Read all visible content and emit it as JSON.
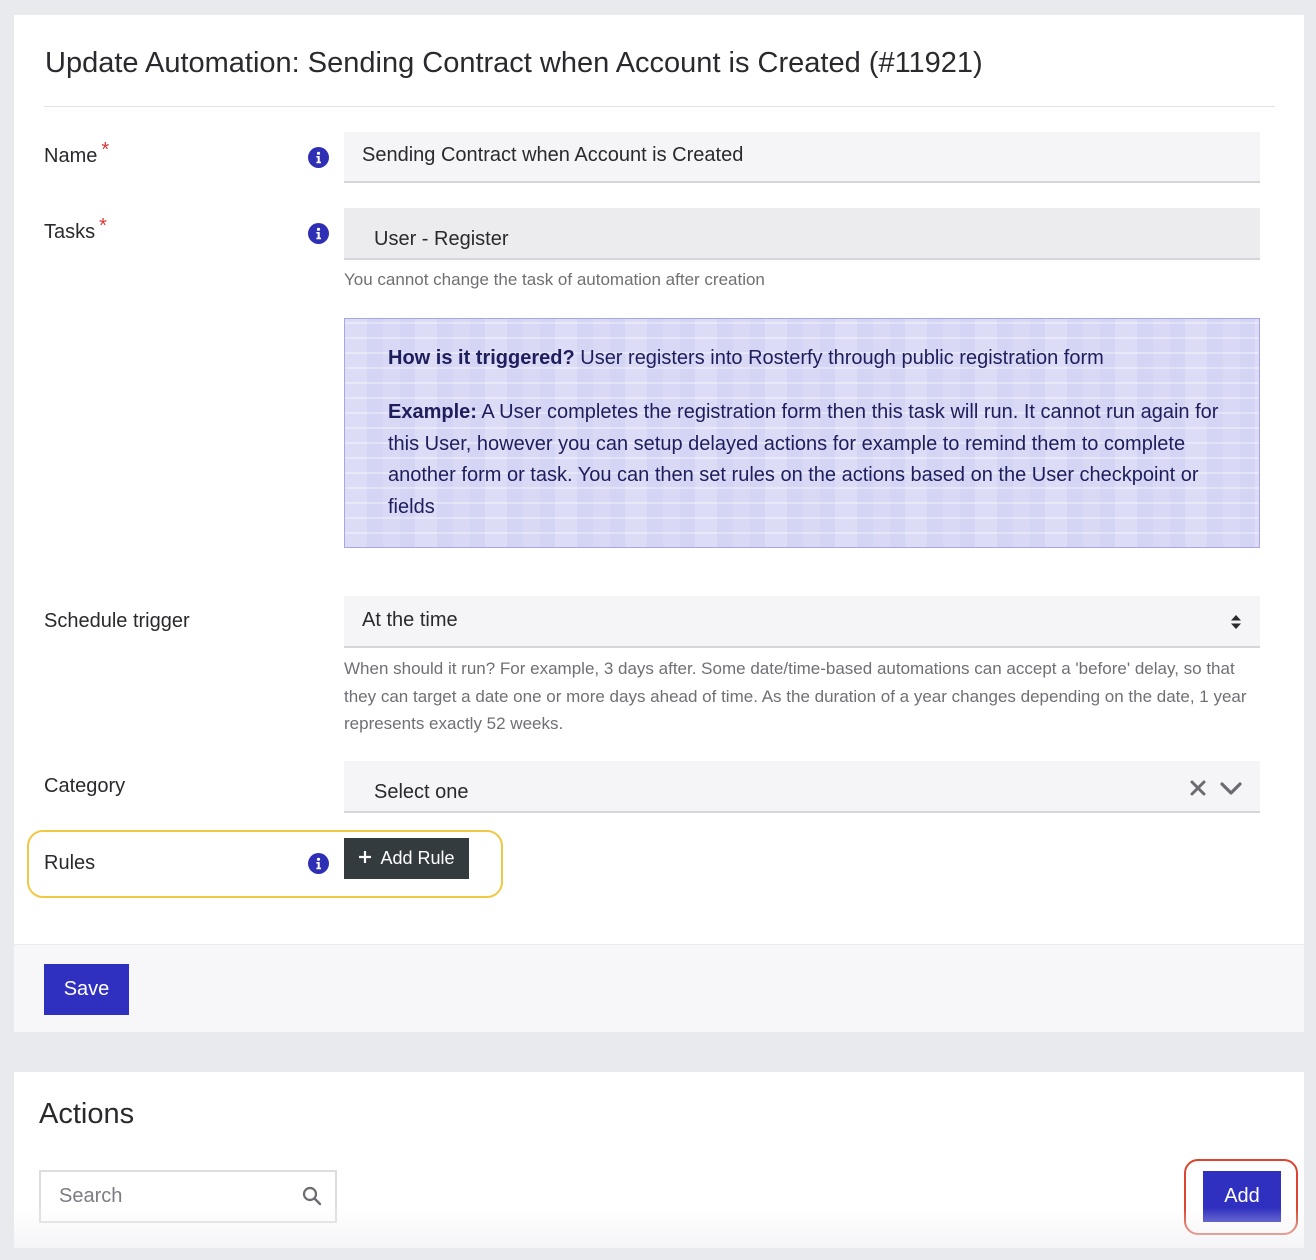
{
  "header": {
    "title": "Update Automation: Sending Contract when Account is Created (#11921)"
  },
  "form": {
    "name": {
      "label": "Name",
      "required_mark": "*",
      "value": "Sending Contract when Account is Created"
    },
    "tasks": {
      "label": "Tasks",
      "required_mark": "*",
      "value": "User - Register",
      "help": "You cannot change the task of automation after creation"
    },
    "callout": {
      "trigger_heading": "How is it triggered?",
      "trigger_text": " User registers into Rosterfy through public registration form",
      "example_heading": "Example:",
      "example_text": " A User completes the registration form then this task will run. It cannot run again for this User, however you can setup delayed actions for example to remind them to complete another form or task. You can then set rules on the actions based on the User checkpoint or fields"
    },
    "schedule_trigger": {
      "label": "Schedule trigger",
      "value": "At the time",
      "help": "When should it run? For example, 3 days after. Some date/time-based automations can accept a 'before' delay, so that they can target a date one or more days ahead of time. As the duration of a year changes depending on the date, 1 year represents exactly 52 weeks."
    },
    "category": {
      "label": "Category",
      "value": "Select one"
    },
    "rules": {
      "label": "Rules",
      "button_label": "Add Rule"
    },
    "save_label": "Save"
  },
  "actions": {
    "title": "Actions",
    "search_placeholder": "Search",
    "add_label": "Add"
  },
  "icons": {
    "info": "info-icon",
    "plus": "plus-icon",
    "sort": "sort-arrows-icon",
    "clear": "clear-x-icon",
    "chevron": "chevron-down-icon",
    "search": "search-icon"
  },
  "colors": {
    "primary": "#3030c0",
    "info_icon": "#2f2fb5",
    "required": "#d93636",
    "callout_bg": "#d4d4f4",
    "callout_text": "#1e1e5c",
    "rules_highlight": "#efc846",
    "add_highlight": "#d9452f",
    "dark_button": "#333b3f"
  }
}
